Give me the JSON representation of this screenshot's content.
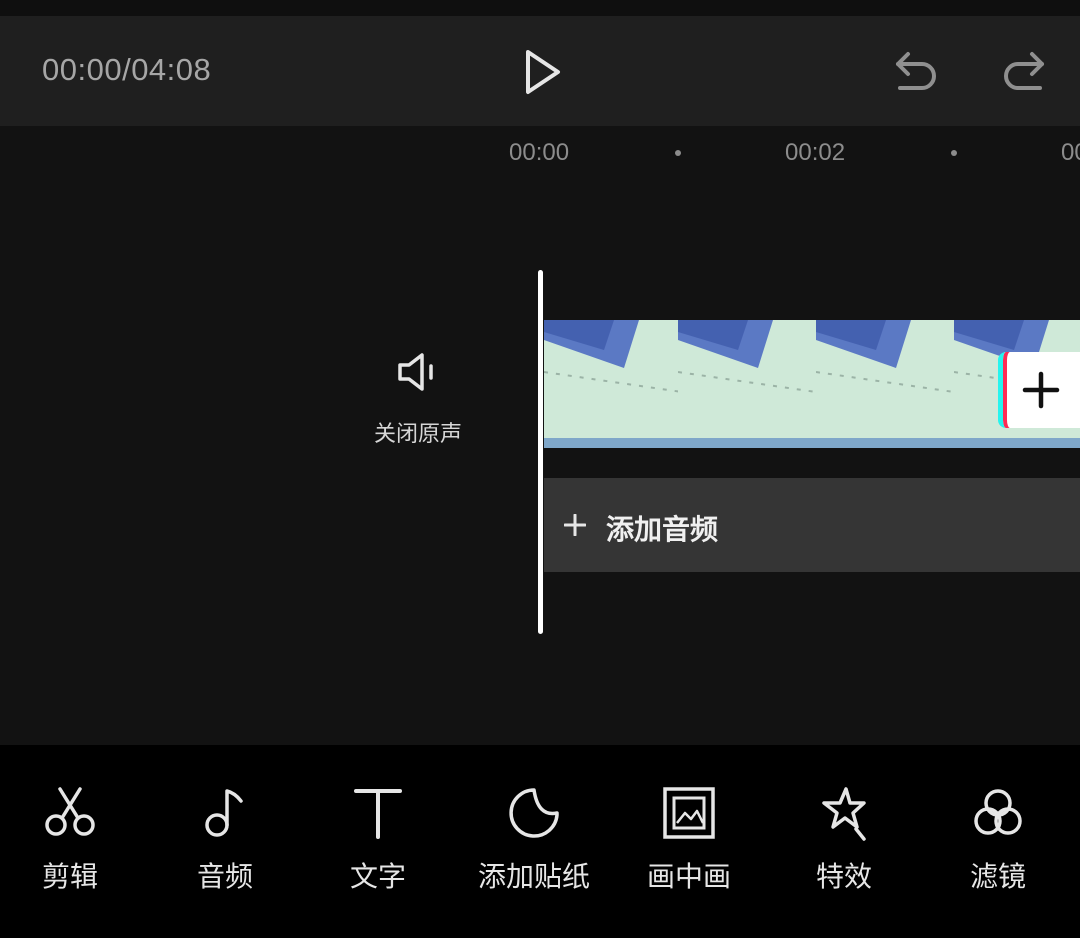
{
  "playbar": {
    "time": "00:00/04:08"
  },
  "ruler": {
    "labels": [
      "00:00",
      "00:02",
      "00"
    ]
  },
  "track": {
    "mute_label": "关闭原声",
    "add_audio_label": "添加音频"
  },
  "toolbar": {
    "items": [
      {
        "label": "剪辑",
        "icon": "scissors-icon"
      },
      {
        "label": "音频",
        "icon": "music-note-icon"
      },
      {
        "label": "文字",
        "icon": "text-icon"
      },
      {
        "label": "添加贴纸",
        "icon": "sticker-icon"
      },
      {
        "label": "画中画",
        "icon": "picture-in-picture-icon"
      },
      {
        "label": "特效",
        "icon": "effects-star-icon"
      },
      {
        "label": "滤镜",
        "icon": "filter-icon"
      }
    ]
  },
  "colors": {
    "accent_cyan": "#25f4ee",
    "accent_red": "#fe2c55",
    "background": "#121212",
    "playbar": "#1f1f1f",
    "toolbar": "#000000"
  }
}
